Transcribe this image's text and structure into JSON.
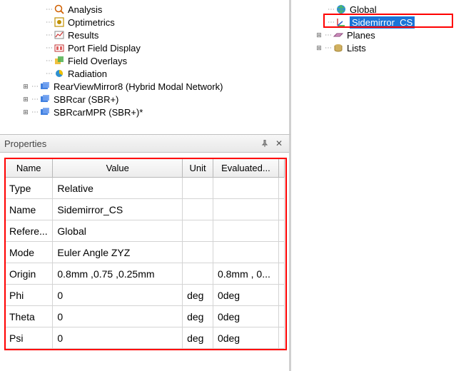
{
  "leftTree": {
    "items": [
      {
        "label": "Analysis",
        "icon": "analysis",
        "indent": 64
      },
      {
        "label": "Optimetrics",
        "icon": "optimetrics",
        "indent": 64
      },
      {
        "label": "Results",
        "icon": "results",
        "indent": 64
      },
      {
        "label": "Port Field Display",
        "icon": "port-field",
        "indent": 64
      },
      {
        "label": "Field Overlays",
        "icon": "field-overlays",
        "indent": 64
      },
      {
        "label": "Radiation",
        "icon": "radiation",
        "indent": 64
      },
      {
        "label": "RearViewMirror8 (Hybrid Modal Network)",
        "icon": "model",
        "indent": 30,
        "expander": "+"
      },
      {
        "label": "SBRcar (SBR+)",
        "icon": "model",
        "indent": 30,
        "expander": "+"
      },
      {
        "label": "SBRcarMPR (SBR+)*",
        "icon": "model",
        "indent": 30,
        "expander": "+"
      }
    ]
  },
  "rightTree": {
    "items": [
      {
        "label": "Global",
        "icon": "globe",
        "indent": 48
      },
      {
        "label": "Sidemirror_CS",
        "icon": "cs",
        "indent": 48,
        "selected": true
      },
      {
        "label": "Planes",
        "icon": "planes",
        "indent": 30,
        "expander": "+"
      },
      {
        "label": "Lists",
        "icon": "lists",
        "indent": 30,
        "expander": "+"
      }
    ]
  },
  "properties": {
    "title": "Properties",
    "columns": {
      "name": "Name",
      "value": "Value",
      "unit": "Unit",
      "eval": "Evaluated..."
    },
    "rows": [
      {
        "name": "Type",
        "value": "Relative",
        "unit": "",
        "eval": ""
      },
      {
        "name": "Name",
        "value": "Sidemirror_CS",
        "unit": "",
        "eval": ""
      },
      {
        "name": "Refere...",
        "value": "Global",
        "unit": "",
        "eval": ""
      },
      {
        "name": "Mode",
        "value": "Euler Angle ZYZ",
        "unit": "",
        "eval": ""
      },
      {
        "name": "Origin",
        "value": "0.8mm ,0.75 ,0.25mm",
        "unit": "",
        "eval": "0.8mm , 0..."
      },
      {
        "name": "Phi",
        "value": "0",
        "unit": "deg",
        "eval": "0deg"
      },
      {
        "name": "Theta",
        "value": "0",
        "unit": "deg",
        "eval": "0deg"
      },
      {
        "name": "Psi",
        "value": "0",
        "unit": "deg",
        "eval": "0deg"
      }
    ]
  }
}
